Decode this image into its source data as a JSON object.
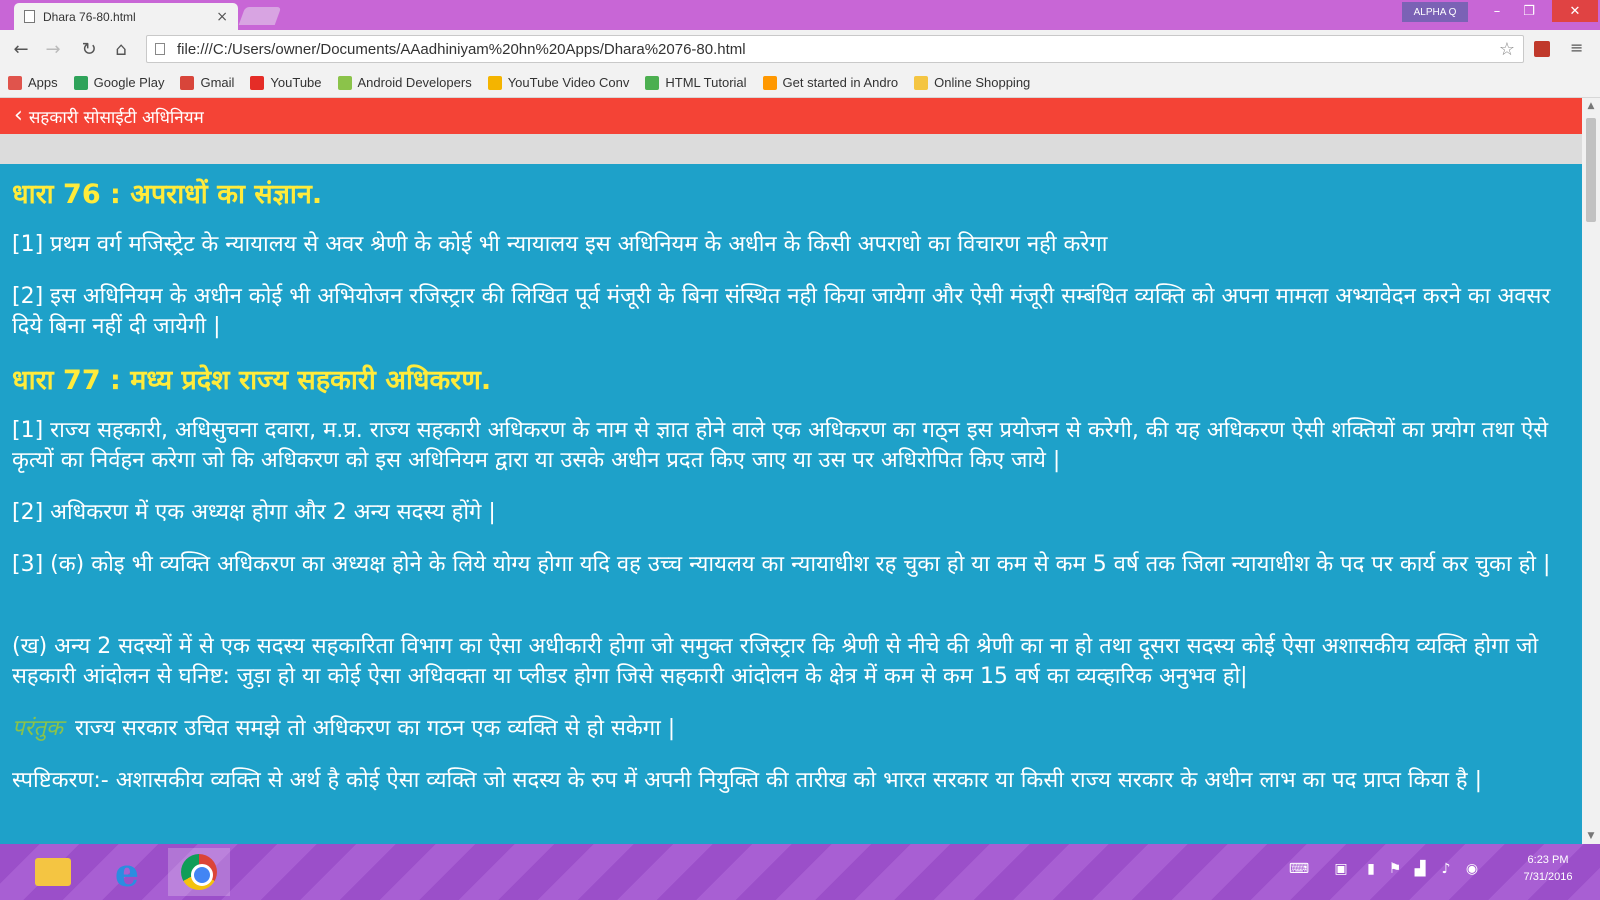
{
  "browser": {
    "tab_title": "Dhara 76-80.html",
    "tab_close": "×",
    "profile_label": "ALPHA Q",
    "url": "file:///C:/Users/owner/Documents/AAadhiniyam%20hn%20Apps/Dhara%2076-80.html",
    "window_controls": {
      "minimize": "–",
      "restore": "❐",
      "close": "✕"
    }
  },
  "bookmarks": [
    {
      "label": "Apps",
      "color": "#e0544c"
    },
    {
      "label": "Google Play",
      "color": "#2fa35a"
    },
    {
      "label": "Gmail",
      "color": "#d8453a"
    },
    {
      "label": "YouTube",
      "color": "#e52d27"
    },
    {
      "label": "Android Developers",
      "color": "#8bc34a"
    },
    {
      "label": "YouTube Video Conv",
      "color": "#f4b400"
    },
    {
      "label": "HTML Tutorial",
      "color": "#4caf50"
    },
    {
      "label": "Get started in Andro",
      "color": "#ff9800"
    },
    {
      "label": "Online Shopping",
      "color": "#f4c542"
    }
  ],
  "app": {
    "title": "सहकारी सोसाईटी अधिनियम",
    "accent": "#f44336",
    "content_bg": "#1ea1c9",
    "heading_color": "#ffeb3b"
  },
  "content": {
    "sec76_heading": "धारा 76 : अपराधों का संज्ञान.",
    "sec76_p1": "[1] प्रथम वर्ग मजिस्ट्रेट के न्यायालय से अवर श्रेणी के कोई भी न्यायालय इस अधिनियम के अधीन के किसी अपराधो का विचारण नही करेगा",
    "sec76_p2": "[2] इस अधिनियम के अधीन कोई भी अभियोजन रजिस्ट्रार की लिखित पूर्व मंजूरी के बिना संस्थित नही किया जायेगा और ऐसी मंजूरी सम्बंधित व्यक्ति को अपना मामला अभ्यावेदन करने का अवसर दिये बिना नहीं दी जायेगी |",
    "sec77_heading": "धारा 77 : मध्य प्रदेश राज्य सहकारी अधिकरण.",
    "sec77_p1": "[1] राज्य सहकारी, अधिसुचना दवारा, म.प्र. राज्य सहकारी अधिकरण के नाम से ज्ञात होने वाले एक अधिकरण का गठ्न इस प्रयोजन से करेगी, की यह अधिकरण ऐसी शक्तियों का प्रयोग तथा ऐसे कृत्यों का निर्वहन करेगा जो कि अधिकरण को इस अधिनियम द्वारा या उसके अधीन प्रदत किए जाए या उस पर अधिरोपित किए जाये |",
    "sec77_p2": "[2] अधिकरण में एक अध्यक्ष होगा और 2 अन्य सदस्य होंगे |",
    "sec77_p3": "[3] (क) कोइ भी व्यक्ति अधिकरण का अध्यक्ष होने के लिये योग्य होगा यदि वह उच्च न्यायलय का न्यायाधीश रह चुका हो या कम से कम 5 वर्ष तक जिला न्यायाधीश के पद पर कार्य कर चुका हो |",
    "sec77_p4": "(ख) अन्य 2 सदस्यों में से एक सदस्य सहकारिता विभाग का ऐसा अधीकारी होगा जो समुक्त रजिस्ट्रार कि श्रेणी से नीचे की श्रेणी का ना हो तथा दूसरा सदस्य कोई ऐसा अशासकीय व्यक्ति होगा जो सहकारी आंदोलन से घनिष्ट: जुड़ा हो या कोई ऐसा अधिवक्ता या प्लीडर होगा जिसे सहकारी आंदोलन के क्षेत्र में कम से कम 15 वर्ष का व्यव्हारिक अनुभव हो|",
    "proviso_label": "परंतुक",
    "proviso_text": "राज्य सरकार उचित समझे तो अधिकरण का गठन एक व्यक्ति से हो सकेगा |",
    "explanation": "स्पष्टिकरण:- अशासकीय व्यक्ति से अर्थ है कोई ऐसा व्यक्ति जो सदस्य के रुप में अपनी नियुक्ति की तारीख को भारत सरकार या किसी राज्य सरकार के अधीन लाभ का पद प्राप्त किया है |"
  },
  "taskbar": {
    "time": "6:23 PM",
    "date": "7/31/2016"
  }
}
